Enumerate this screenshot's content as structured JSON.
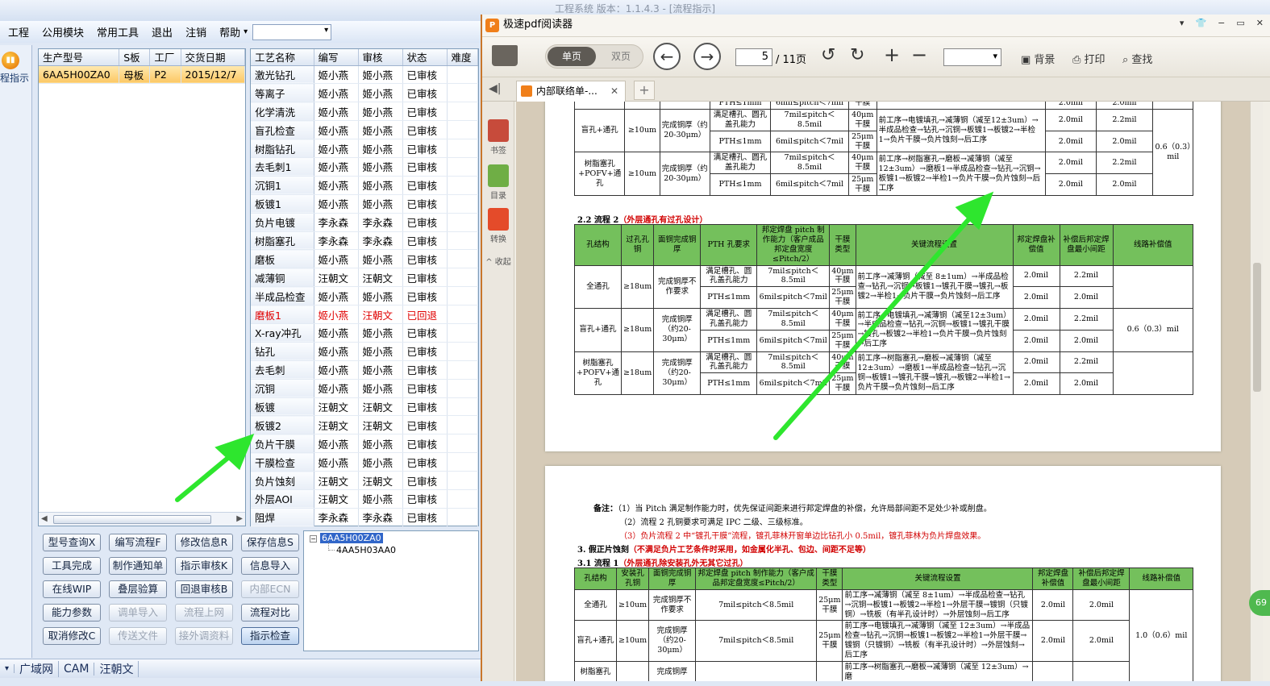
{
  "app": {
    "title": "工程系统  版本：1.1.4.3 - [流程指示]",
    "window_controls": [
      "▾",
      "⊟",
      "▭",
      "✕"
    ]
  },
  "menu": {
    "items": [
      "工程",
      "公用模块",
      "常用工具",
      "退出",
      "注销",
      "帮助"
    ],
    "help_arrow": "▾",
    "combo_value": ""
  },
  "left_strip": {
    "guide_label": "程指示"
  },
  "model_grid": {
    "columns": [
      "生产型号",
      "S板",
      "工厂",
      "交货日期"
    ],
    "rows": [
      [
        "6AA5H00ZA0",
        "母板",
        "P2",
        "2015/12/7"
      ]
    ]
  },
  "process_grid": {
    "columns": [
      "工艺名称",
      "编写",
      "审核",
      "状态",
      "难度"
    ],
    "rows": [
      [
        "激光钻孔",
        "姬小燕",
        "姬小燕",
        "已审核",
        ""
      ],
      [
        "等离子",
        "姬小燕",
        "姬小燕",
        "已审核",
        ""
      ],
      [
        "化学清洗",
        "姬小燕",
        "姬小燕",
        "已审核",
        ""
      ],
      [
        "盲孔检查",
        "姬小燕",
        "姬小燕",
        "已审核",
        ""
      ],
      [
        "树脂钻孔",
        "姬小燕",
        "姬小燕",
        "已审核",
        ""
      ],
      [
        "去毛刺1",
        "姬小燕",
        "姬小燕",
        "已审核",
        ""
      ],
      [
        "沉铜1",
        "姬小燕",
        "姬小燕",
        "已审核",
        ""
      ],
      [
        "板镀1",
        "姬小燕",
        "姬小燕",
        "已审核",
        ""
      ],
      [
        "负片电镀",
        "李永森",
        "李永森",
        "已审核",
        ""
      ],
      [
        "树脂塞孔",
        "李永森",
        "李永森",
        "已审核",
        ""
      ],
      [
        "磨板",
        "姬小燕",
        "姬小燕",
        "已审核",
        ""
      ],
      [
        "减薄铜",
        "汪朝文",
        "汪朝文",
        "已审核",
        ""
      ],
      [
        "半成品检查",
        "姬小燕",
        "姬小燕",
        "已审核",
        ""
      ],
      [
        "磨板1",
        "姬小燕",
        "汪朝文",
        "已回退",
        ""
      ],
      [
        "X-ray冲孔",
        "姬小燕",
        "姬小燕",
        "已审核",
        ""
      ],
      [
        "钻孔",
        "姬小燕",
        "姬小燕",
        "已审核",
        ""
      ],
      [
        "去毛刺",
        "姬小燕",
        "姬小燕",
        "已审核",
        ""
      ],
      [
        "沉铜",
        "姬小燕",
        "姬小燕",
        "已审核",
        ""
      ],
      [
        "板镀",
        "汪朝文",
        "汪朝文",
        "已审核",
        ""
      ],
      [
        "板镀2",
        "汪朝文",
        "汪朝文",
        "已审核",
        ""
      ],
      [
        "负片干膜",
        "姬小燕",
        "姬小燕",
        "已审核",
        ""
      ],
      [
        "干膜检查",
        "姬小燕",
        "姬小燕",
        "已审核",
        ""
      ],
      [
        "负片蚀刻",
        "汪朝文",
        "汪朝文",
        "已审核",
        ""
      ],
      [
        "外层AOI",
        "汪朝文",
        "姬小燕",
        "已审核",
        ""
      ],
      [
        "阻焊",
        "李永森",
        "李永森",
        "已审核",
        ""
      ]
    ],
    "returned_row_index": 13
  },
  "buttons": [
    {
      "label": "型号查询X",
      "enabled": true
    },
    {
      "label": "编写流程F",
      "enabled": true
    },
    {
      "label": "修改信息R",
      "enabled": true
    },
    {
      "label": "保存信息S",
      "enabled": true
    },
    {
      "label": "工具完成",
      "enabled": true
    },
    {
      "label": "制作通知单",
      "enabled": true
    },
    {
      "label": "指示审核K",
      "enabled": true
    },
    {
      "label": "信息导入",
      "enabled": true
    },
    {
      "label": "在线WIP",
      "enabled": true
    },
    {
      "label": "叠层验算",
      "enabled": true
    },
    {
      "label": "回退审核B",
      "enabled": true
    },
    {
      "label": "内部ECN",
      "enabled": false
    },
    {
      "label": "能力参数",
      "enabled": true
    },
    {
      "label": "调单导入",
      "enabled": false
    },
    {
      "label": "流程上网",
      "enabled": false
    },
    {
      "label": "流程对比",
      "enabled": true
    },
    {
      "label": "取消修改C",
      "enabled": true
    },
    {
      "label": "传送文件",
      "enabled": false
    },
    {
      "label": "接外调资料",
      "enabled": false
    },
    {
      "label": "指示检查",
      "enabled": true,
      "active": true
    }
  ],
  "tree": {
    "root": "6AA5H00ZA0",
    "child": "4AA5H03AA0",
    "toggle": "−"
  },
  "statusbar": {
    "items": [
      "▾",
      "广域网",
      "CAM",
      "汪朝文"
    ]
  },
  "pdf": {
    "title": "极速pdf阅读器",
    "logo": "P",
    "window_controls": [
      "▾",
      "👕",
      "−",
      "▭",
      "✕"
    ],
    "toolbar": {
      "single": "单页",
      "double": "双页",
      "page": "5",
      "total": "/ 11页",
      "background": "背景",
      "print": "打印",
      "find": "查找",
      "zoom": ""
    },
    "tab": {
      "label": "内部联络单-...",
      "close": "✕",
      "add": "+"
    },
    "side": {
      "bookmark": "书签",
      "toc": "目录",
      "convert": "转换",
      "fold": "^ 收起"
    },
    "badge": "69",
    "page1": {
      "top_rows": [
        {
          "c1": "",
          "c2": "",
          "c3": "",
          "c4": "PTH≤1mm",
          "c5": "6mil≤pitch＜7mil",
          "c6": "干膜",
          "c7": "",
          "c8": "2.0mil",
          "c9": "2.0mil"
        }
      ],
      "blockA": [
        {
          "struct": "盲孔+通孔",
          "ring": "≥10um",
          "plate": "完成铜厚（约20-30μm）",
          "r1": {
            "pth": "满足槽孔、圆孔盖孔能力",
            "pitch": "7mil≤pitch＜8.5mil",
            "film": "40μm干膜",
            "flow": "前工序→电镀填孔→减薄铜（减至12±3um）→半成品检查→钻孔→沉铜→板镀1→板镀2→半检1→负片干膜→负片蚀刻→后工序",
            "c1": "2.0mil",
            "c2": "2.2mil"
          },
          "r2": {
            "pth": "PTH≤1mm",
            "pitch": "6mil≤pitch＜7mil",
            "film": "25μm干膜",
            "c1": "2.0mil",
            "c2": "2.0mil"
          }
        },
        {
          "struct": "树脂塞孔+POFV+通孔",
          "ring": "≥10um",
          "plate": "完成铜厚（约20-30μm）",
          "r1": {
            "pth": "满足槽孔、圆孔盖孔能力",
            "pitch": "7mil≤pitch＜8.5mil",
            "film": "40μm干膜",
            "flow": "前工序→树脂塞孔→磨板→减薄铜（减至12±3um）→磨板1→半成品检查→钻孔→沉铜→板镀1→板镀2→半检1→负片干膜→负片蚀刻→后工序",
            "c1": "2.0mil",
            "c2": "2.2mil"
          },
          "r2": {
            "pth": "PTH≤1mm",
            "pitch": "6mil≤pitch＜7mil",
            "film": "25μm干膜",
            "c1": "2.0mil",
            "c2": "2.0mil"
          }
        }
      ],
      "blockA_last": "0.6（0.3）mil",
      "sec22_title": "2.2 流程 2",
      "sec22_note": "（外层通孔有过孔设计）",
      "headers": [
        "孔结构",
        "过孔孔铜",
        "面铜完成铜厚",
        "PTH 孔要求",
        "邦定焊盘 pitch 制作能力（客户成品邦定盘宽度≤Pitch/2）",
        "干膜类型",
        "关键流程设置",
        "邦定焊盘补偿值",
        "补偿后邦定焊盘最小间距",
        "线路补偿值"
      ],
      "blockB": [
        {
          "struct": "全通孔",
          "ring": "≥18um",
          "plate": "完成铜厚不作要求",
          "r1": {
            "pth": "满足槽孔、圆孔盖孔能力",
            "pitch": "7mil≤pitch＜8.5mil",
            "film": "40μm干膜",
            "flow": "前工序→减薄铜（减至 8±1um）→半成品检查→钻孔→沉铜→板镀1→镀孔干膜→镀孔→板镀2→半检1→负片干膜→负片蚀刻→后工序",
            "c1": "2.0mil",
            "c2": "2.2mil"
          },
          "r2": {
            "pth": "PTH≤1mm",
            "pitch": "6mil≤pitch＜7mil",
            "film": "25μm干膜",
            "c1": "2.0mil",
            "c2": "2.0mil"
          }
        },
        {
          "struct": "盲孔+通孔",
          "ring": "≥18um",
          "plate": "完成铜厚（约20-30μm）",
          "r1": {
            "pth": "满足槽孔、圆孔盖孔能力",
            "pitch": "7mil≤pitch＜8.5mil",
            "film": "40μm干膜",
            "flow": "前工序→电镀填孔→减薄铜（减至12±3um）→半成品检查→钻孔→沉铜→板镀1→镀孔干膜→镀孔→板镀2→半检1→负片干膜→负片蚀刻→后工序",
            "c1": "2.0mil",
            "c2": "2.2mil"
          },
          "r2": {
            "pth": "PTH≤1mm",
            "pitch": "6mil≤pitch＜7mil",
            "film": "25μm干膜",
            "c1": "2.0mil",
            "c2": "2.0mil"
          }
        },
        {
          "struct": "树脂塞孔+POFV+通孔",
          "ring": "≥18um",
          "plate": "完成铜厚（约20-30μm）",
          "r1": {
            "pth": "满足槽孔、圆孔盖孔能力",
            "pitch": "7mil≤pitch＜8.5mil",
            "film": "40μm干膜",
            "flow": "前工序→树脂塞孔→磨板→减薄铜（减至12±3um）→磨板1→半成品检查→钻孔→沉铜→板镀1→镀孔干膜→镀孔→板镀2→半检1→负片干膜→负片蚀刻→后工序",
            "c1": "2.0mil",
            "c2": "2.2mil"
          },
          "r2": {
            "pth": "PTH≤1mm",
            "pitch": "6mil≤pitch＜7mil",
            "film": "25μm干膜",
            "c1": "2.0mil",
            "c2": "2.0mil"
          }
        }
      ],
      "blockB_last": "0.6（0.3）mil"
    },
    "page2": {
      "note_label": "备注：",
      "note1": "（1）当 Pitch 满足制作能力时，优先保证间距来进行邦定焊盘的补偿，允许局部间距不足处少补或削盘。",
      "note2": "（2）流程 2 孔铜要求可满足 IPC 二级、三级标准。",
      "note3": "（3）负片流程 2 中“镀孔干膜”流程，镀孔菲林开窗单边比钻孔小 0.5mil，镀孔菲林为负片焊盘效果。",
      "sec3_title": "3. 假正片蚀刻",
      "sec3_note": "（不满足负片工艺条件时采用，如金属化半孔、包边、间距不足等）",
      "sec31_title": "3.1 流程 1",
      "sec31_note": "（外层通孔除安装孔外无其它过孔）",
      "headers": [
        "孔结构",
        "安装孔孔铜",
        "面铜完成铜厚",
        "邦定焊盘 pitch 制作能力（客户成品邦定盘宽度≤Pitch/2）",
        "干膜类型",
        "关键流程设置",
        "邦定焊盘补偿值",
        "补偿后邦定焊盘最小间距",
        "线路补偿值"
      ],
      "rows": [
        {
          "struct": "全通孔",
          "ring": "≥10um",
          "plate": "完成铜厚不作要求",
          "pitch": "7mil≤pitch＜8.5mil",
          "film": "25μm干膜",
          "flow": "前工序→减薄铜（减至 8±1um）→半成品检查→钻孔→沉铜→板镀1→板镀2→半检1→外层干膜→镀铜（只镀铜）→铣板（有半孔设计时）→外层蚀刻→后工序",
          "c1": "2.0mil",
          "c2": "2.0mil"
        },
        {
          "struct": "盲孔+通孔",
          "ring": "≥10um",
          "plate": "完成铜厚（约20-30μm）",
          "pitch": "7mil≤pitch＜8.5mil",
          "film": "25μm干膜",
          "flow": "前工序→电镀填孔→减薄铜（减至 12±3um）→半成品检查→钻孔→沉铜→板镀1→板镀2→半检1→外层干膜→镀铜（只镀铜）→铣板（有半孔设计时）→外层蚀刻→后工序",
          "c1": "2.0mil",
          "c2": "2.0mil"
        },
        {
          "struct": "树脂塞孔",
          "ring": "",
          "plate": "完成铜厚",
          "pitch": "",
          "film": "",
          "flow": "前工序→树脂塞孔→磨板→减薄铜（减至 12±3um）→磨",
          "c1": "",
          "c2": ""
        }
      ],
      "last": "1.0（0.6）mil"
    }
  },
  "colors": {
    "accent": "#74c05c",
    "arrow": "#2ee62e",
    "returned": "#e00000",
    "selection": "#fcc865"
  }
}
